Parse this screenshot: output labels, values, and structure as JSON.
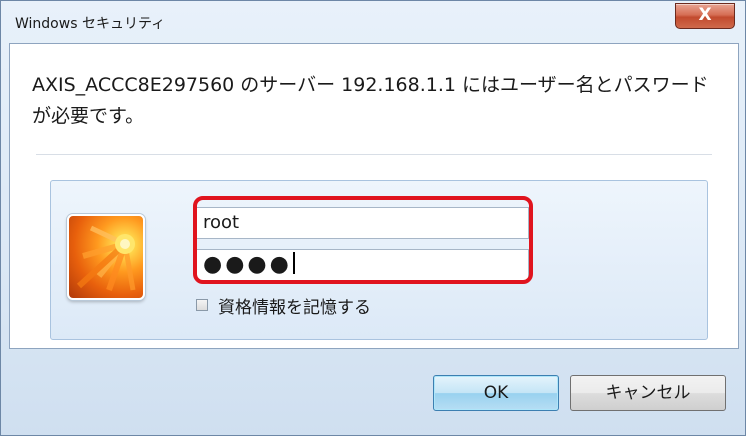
{
  "window": {
    "title": "Windows セキュリティ",
    "close_label": "X"
  },
  "dialog": {
    "message": "AXIS_ACCC8E297560 のサーバー 192.168.1.1 にはユーザー名とパスワードが必要です。",
    "username_value": "root",
    "password_masked": "●●●●",
    "remember_label": "資格情報を記憶する",
    "remember_checked": false
  },
  "buttons": {
    "ok_label": "OK",
    "cancel_label": "キャンセル"
  },
  "colors": {
    "highlight": "#e0141e",
    "close_button": "#c24a2e",
    "ok_button_border": "#3c7fb1"
  },
  "icons": {
    "avatar": "user-tile-flower-icon",
    "close": "close-icon"
  }
}
